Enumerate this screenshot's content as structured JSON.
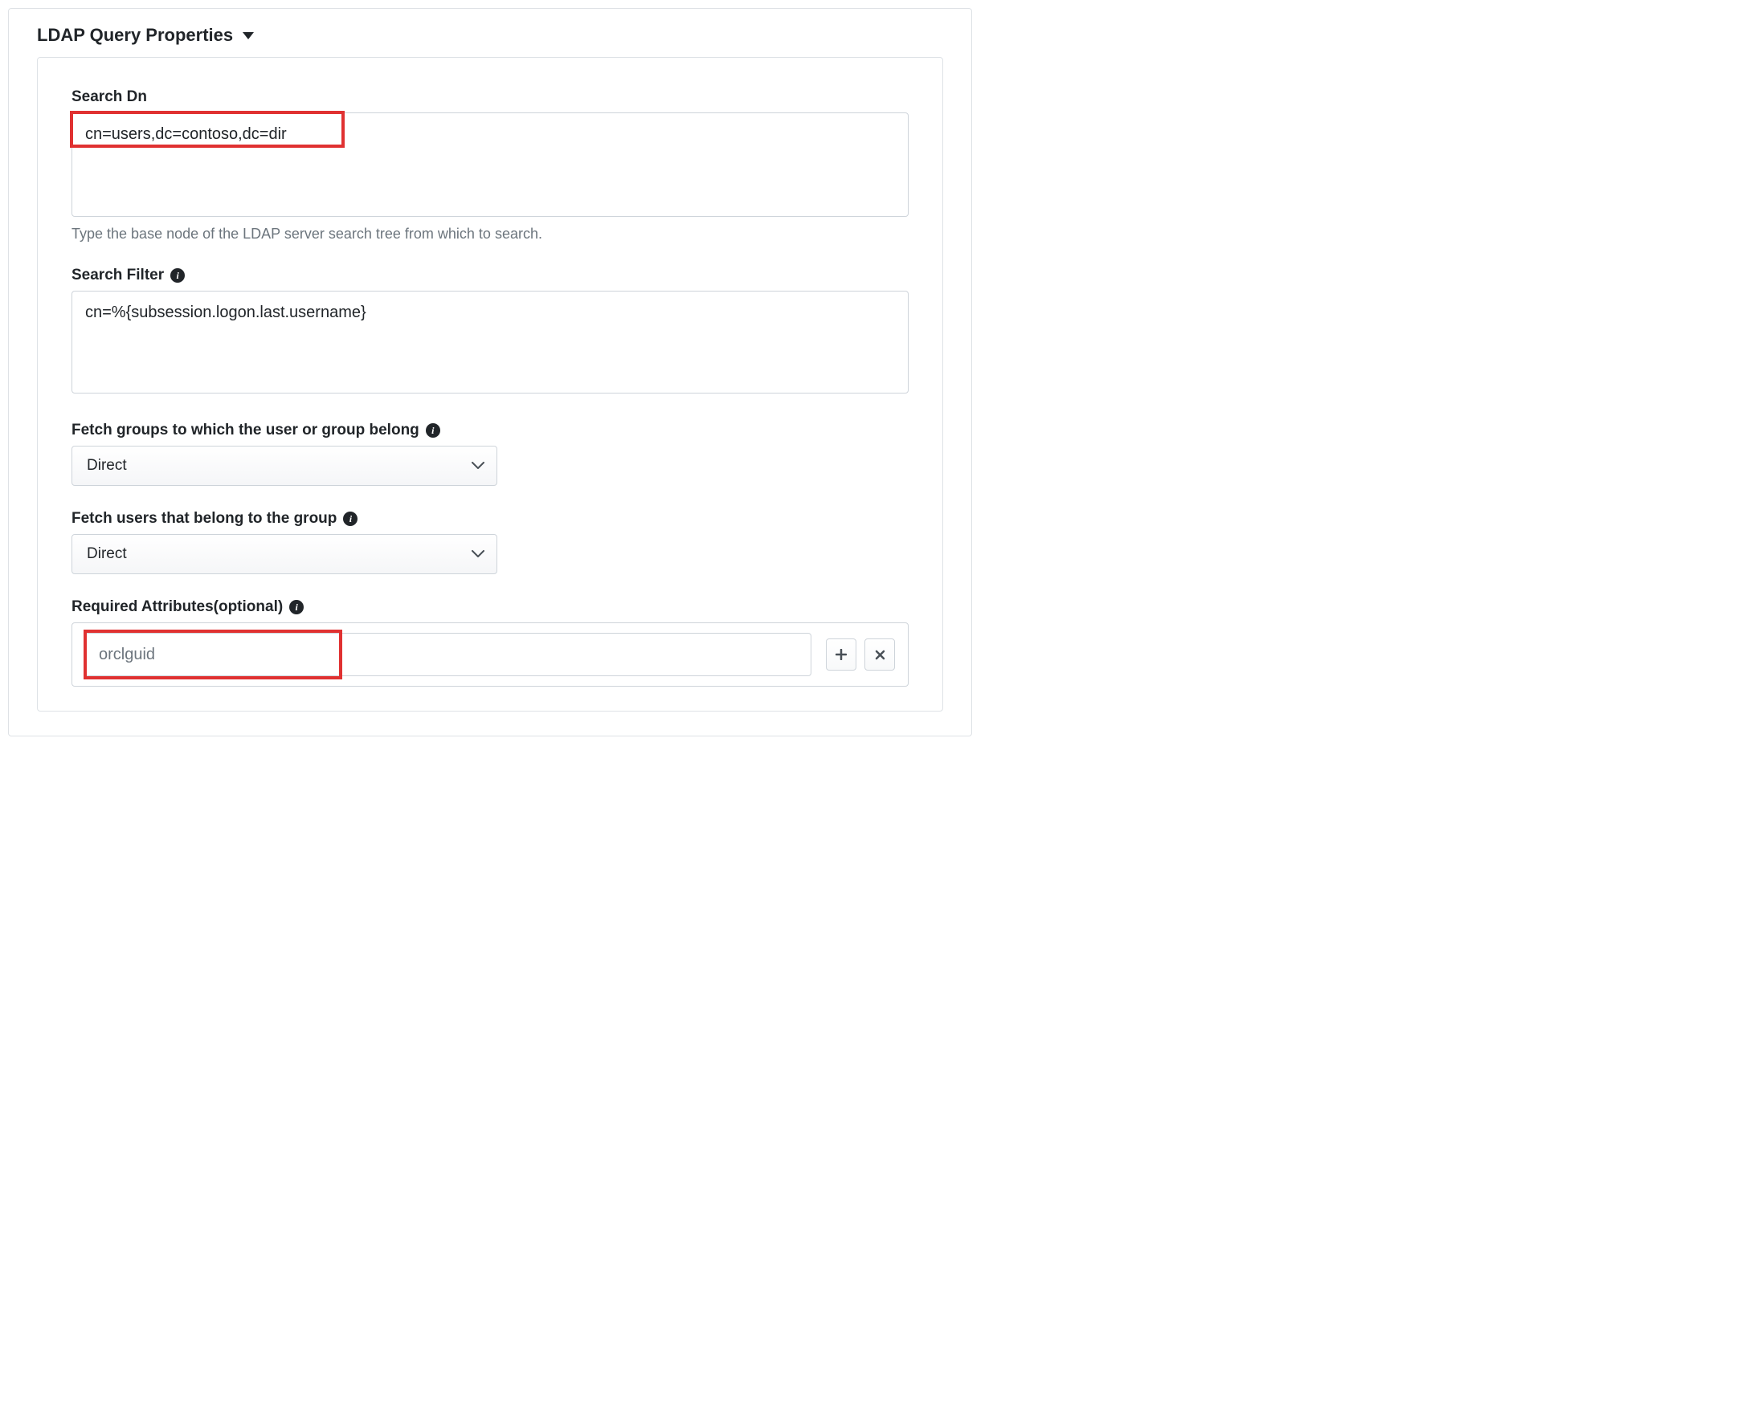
{
  "section": {
    "title": "LDAP Query Properties"
  },
  "searchDn": {
    "label": "Search Dn",
    "value": "cn=users,dc=contoso,dc=dir",
    "hint": "Type the base node of the LDAP server search tree from which to search."
  },
  "searchFilter": {
    "label": "Search Filter",
    "value": "cn=%{subsession.logon.last.username}"
  },
  "fetchGroups": {
    "label": "Fetch groups to which the user or group belong",
    "value": "Direct"
  },
  "fetchUsers": {
    "label": "Fetch users that belong to the group",
    "value": "Direct"
  },
  "requiredAttrs": {
    "label": "Required Attributes(optional)",
    "placeholder": "orclguid"
  },
  "icons": {
    "info": "i",
    "plus": "+",
    "times": "×"
  }
}
